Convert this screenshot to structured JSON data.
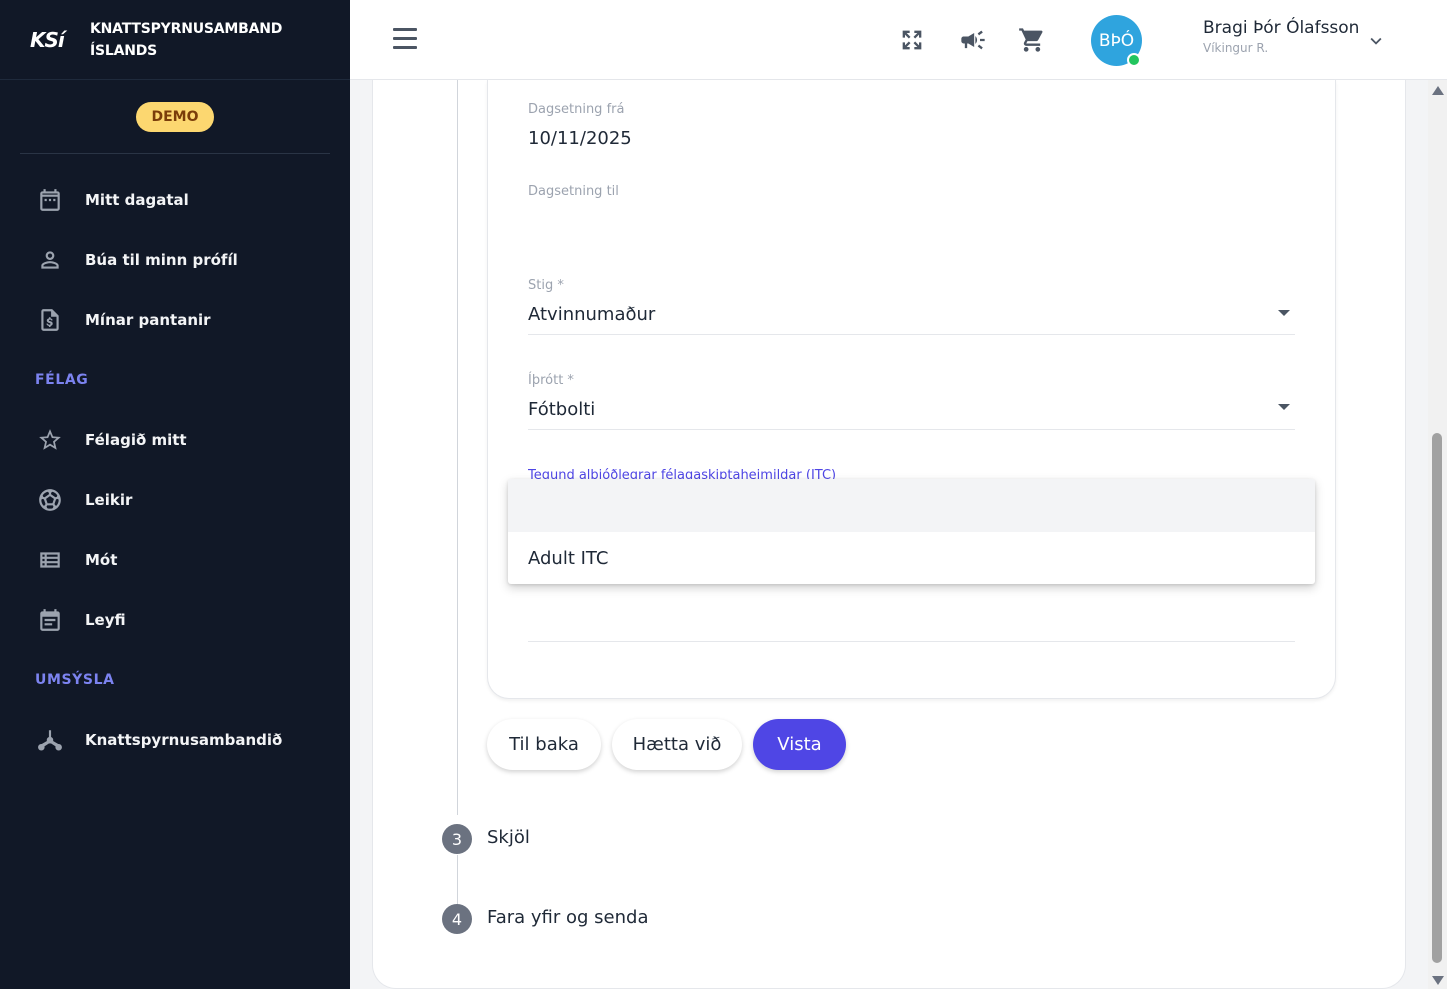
{
  "brand": {
    "logo": "KSí",
    "name_line1": "KNATTSPYRNUSAMBAND",
    "name_line2": "ÍSLANDS"
  },
  "demo_badge": "DEMO",
  "sidebar": {
    "items": [
      {
        "label": "Mitt dagatal",
        "icon": "calendar-icon"
      },
      {
        "label": "Búa til minn prófíl",
        "icon": "person-icon"
      },
      {
        "label": "Mínar pantanir",
        "icon": "invoice-icon"
      }
    ],
    "section_felag": "FÉLAG",
    "felag_items": [
      {
        "label": "Félagið mitt",
        "icon": "star-icon"
      },
      {
        "label": "Leikir",
        "icon": "soccer-ball-icon"
      },
      {
        "label": "Mót",
        "icon": "table-list-icon"
      },
      {
        "label": "Leyfi",
        "icon": "license-calendar-icon"
      }
    ],
    "section_umsysla": "UMSÝSLA",
    "umsysla_items": [
      {
        "label": "Knattspyrnusambandið",
        "icon": "hub-icon"
      }
    ]
  },
  "header": {
    "icons": [
      "fullscreen-icon",
      "megaphone-icon",
      "cart-icon"
    ],
    "avatar_initials": "BÞÓ",
    "user_name": "Bragi Þór Ólafsson",
    "user_club": "Víkingur R."
  },
  "form": {
    "date_from_label": "Dagsetning frá",
    "date_from_value": "10/11/2025",
    "date_to_label": "Dagsetning til",
    "date_to_value": "",
    "level_label": "Stig *",
    "level_value": "Atvinnumaður",
    "sport_label": "Íþrótt *",
    "sport_value": "Fótbolti",
    "itc_label": "Tegund alþjóðlegrar félagaskiptaheimildar (ITC)",
    "itc_options": [
      "",
      "Adult ITC"
    ]
  },
  "buttons": {
    "back": "Til baka",
    "cancel": "Hætta við",
    "save": "Vista"
  },
  "steps": [
    {
      "number": "3",
      "label": "Skjöl"
    },
    {
      "number": "4",
      "label": "Fara yfir og senda"
    }
  ],
  "colors": {
    "sidebar_bg": "#111827",
    "accent": "#4f46e5",
    "avatar": "#2fa4de",
    "demo_badge": "#fcd770",
    "section_title": "#7c83f0"
  }
}
